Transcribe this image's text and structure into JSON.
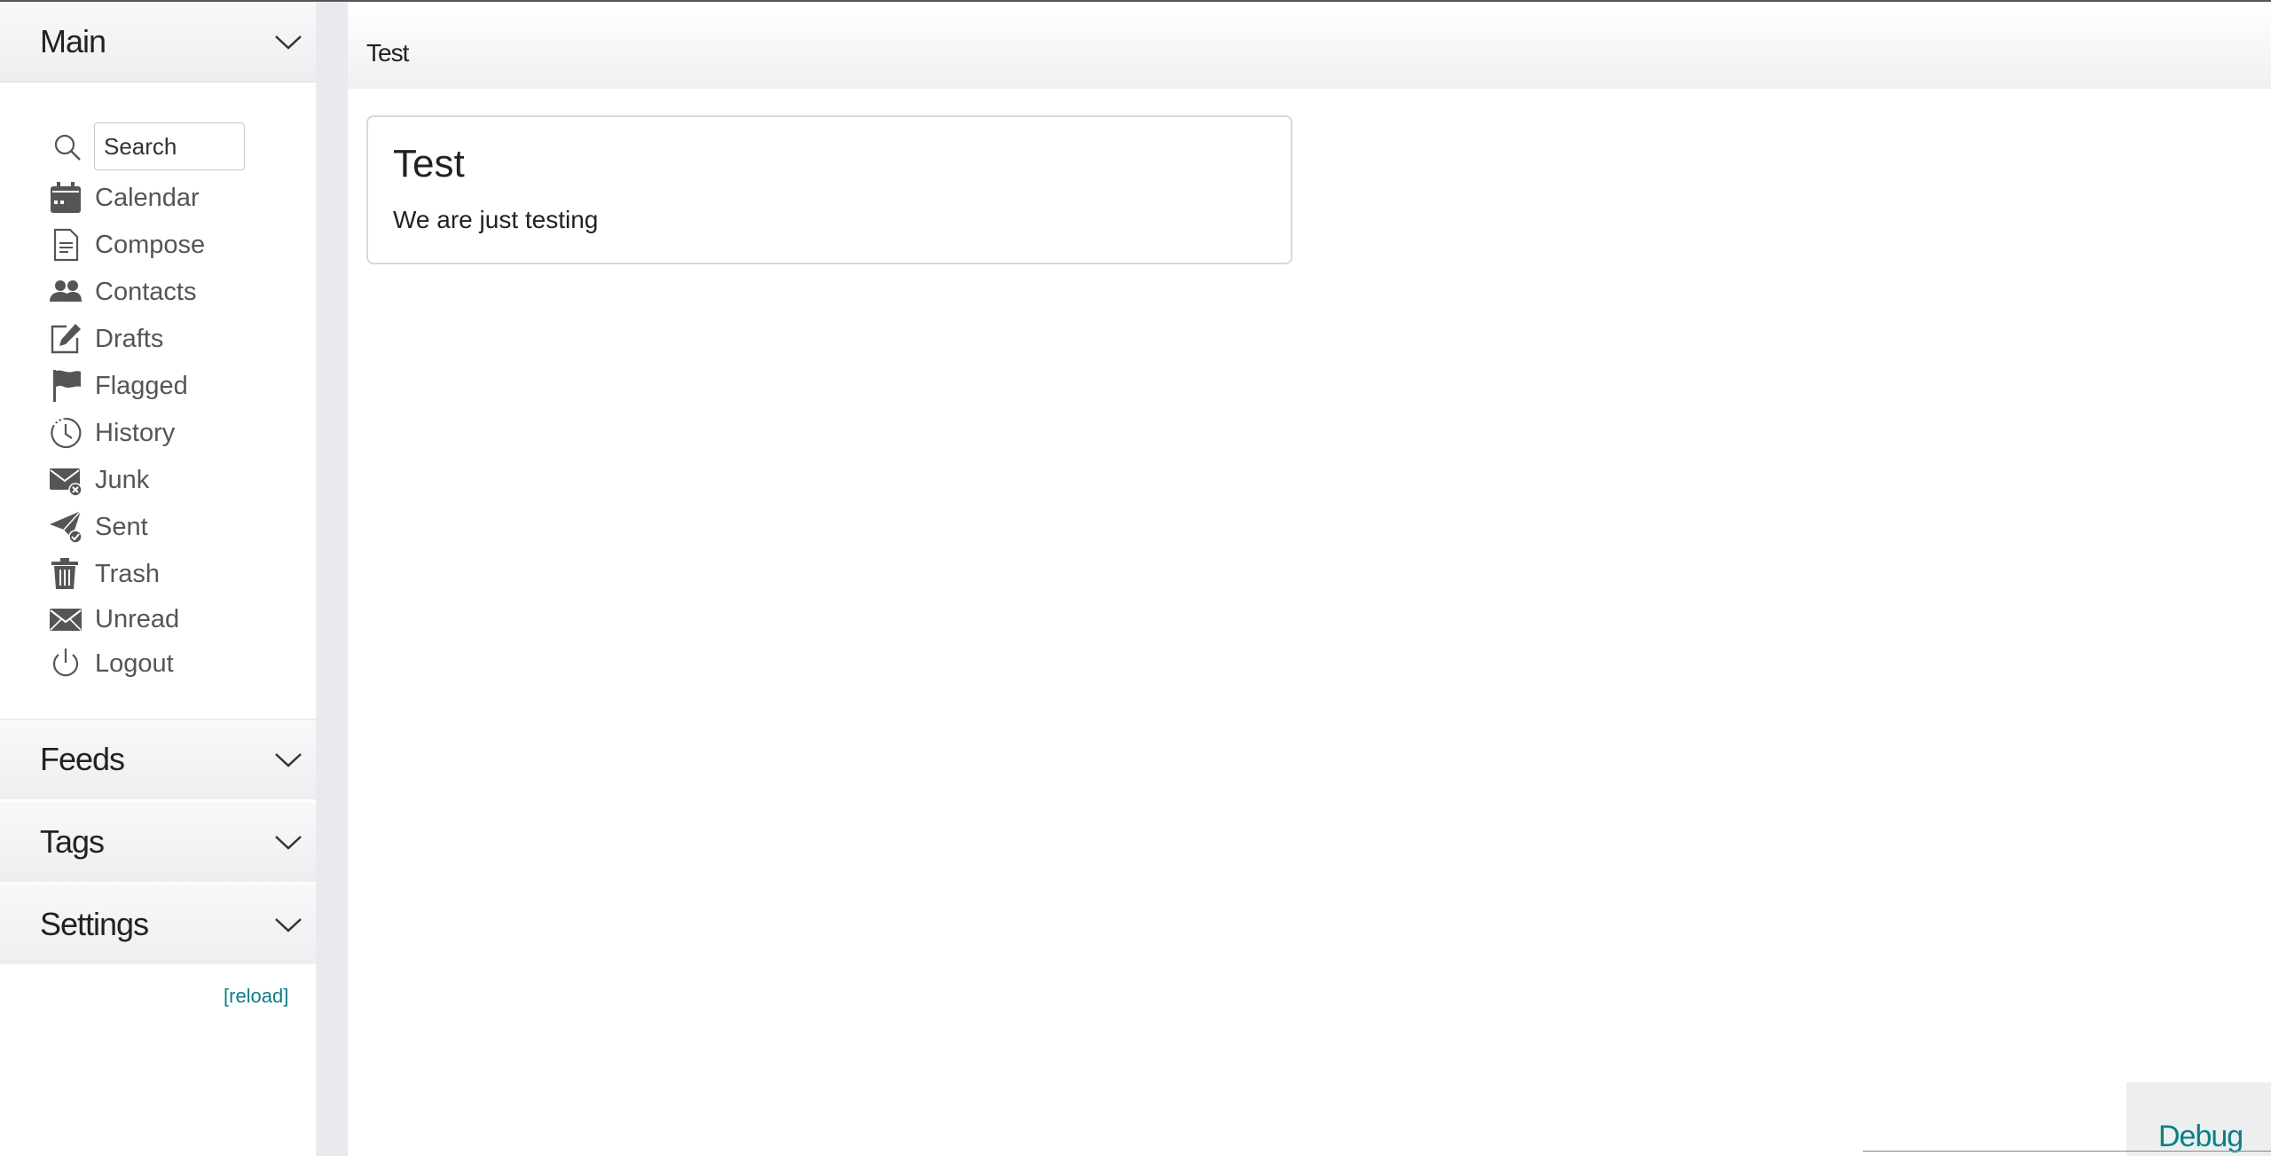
{
  "sidebar": {
    "sections": {
      "main": {
        "title": "Main"
      },
      "feeds": {
        "title": "Feeds"
      },
      "tags": {
        "title": "Tags"
      },
      "settings": {
        "title": "Settings"
      }
    },
    "search": {
      "placeholder": "Search"
    },
    "items": [
      {
        "label": "Calendar",
        "icon": "calendar-icon"
      },
      {
        "label": "Compose",
        "icon": "document-icon"
      },
      {
        "label": "Contacts",
        "icon": "people-icon"
      },
      {
        "label": "Drafts",
        "icon": "pencil-square-icon"
      },
      {
        "label": "Flagged",
        "icon": "flag-icon"
      },
      {
        "label": "History",
        "icon": "clock-icon"
      },
      {
        "label": "Junk",
        "icon": "envelope-x-icon"
      },
      {
        "label": "Sent",
        "icon": "send-check-icon"
      },
      {
        "label": "Trash",
        "icon": "trash-icon"
      },
      {
        "label": "Unread",
        "icon": "envelope-icon"
      },
      {
        "label": "Logout",
        "icon": "power-icon"
      }
    ],
    "reload_label": "[reload]"
  },
  "main": {
    "header_title": "Test",
    "card": {
      "title": "Test",
      "body": "We are just testing"
    }
  },
  "debug_label": "Debug",
  "colors": {
    "accent": "#0a7f86",
    "icon": "#555555",
    "gutter": "#e8eaee"
  }
}
